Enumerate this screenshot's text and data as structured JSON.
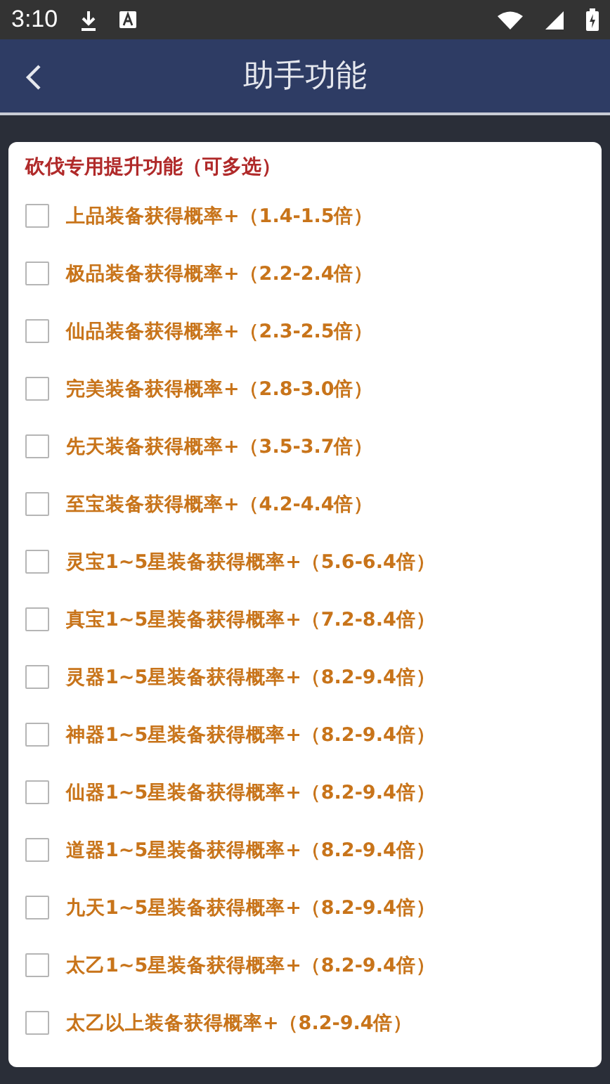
{
  "status_bar": {
    "time": "3:10"
  },
  "header": {
    "title": "助手功能"
  },
  "section": {
    "title": "砍伐专用提升功能（可多选）",
    "options": [
      {
        "label": "上品装备获得概率+（1.4-1.5倍）",
        "checked": false
      },
      {
        "label": "极品装备获得概率+（2.2-2.4倍）",
        "checked": false
      },
      {
        "label": "仙品装备获得概率+（2.3-2.5倍）",
        "checked": false
      },
      {
        "label": "完美装备获得概率+（2.8-3.0倍）",
        "checked": false
      },
      {
        "label": "先天装备获得概率+（3.5-3.7倍）",
        "checked": false
      },
      {
        "label": "至宝装备获得概率+（4.2-4.4倍）",
        "checked": false
      },
      {
        "label": "灵宝1~5星装备获得概率+（5.6-6.4倍）",
        "checked": false
      },
      {
        "label": "真宝1~5星装备获得概率+（7.2-8.4倍）",
        "checked": false
      },
      {
        "label": "灵器1~5星装备获得概率+（8.2-9.4倍）",
        "checked": false
      },
      {
        "label": "神器1~5星装备获得概率+（8.2-9.4倍）",
        "checked": false
      },
      {
        "label": "仙器1~5星装备获得概率+（8.2-9.4倍）",
        "checked": false
      },
      {
        "label": "道器1~5星装备获得概率+（8.2-9.4倍）",
        "checked": false
      },
      {
        "label": "九天1~5星装备获得概率+（8.2-9.4倍）",
        "checked": false
      },
      {
        "label": "太乙1~5星装备获得概率+（8.2-9.4倍）",
        "checked": false
      },
      {
        "label": "太乙以上装备获得概率+（8.2-9.4倍）",
        "checked": false
      }
    ]
  }
}
